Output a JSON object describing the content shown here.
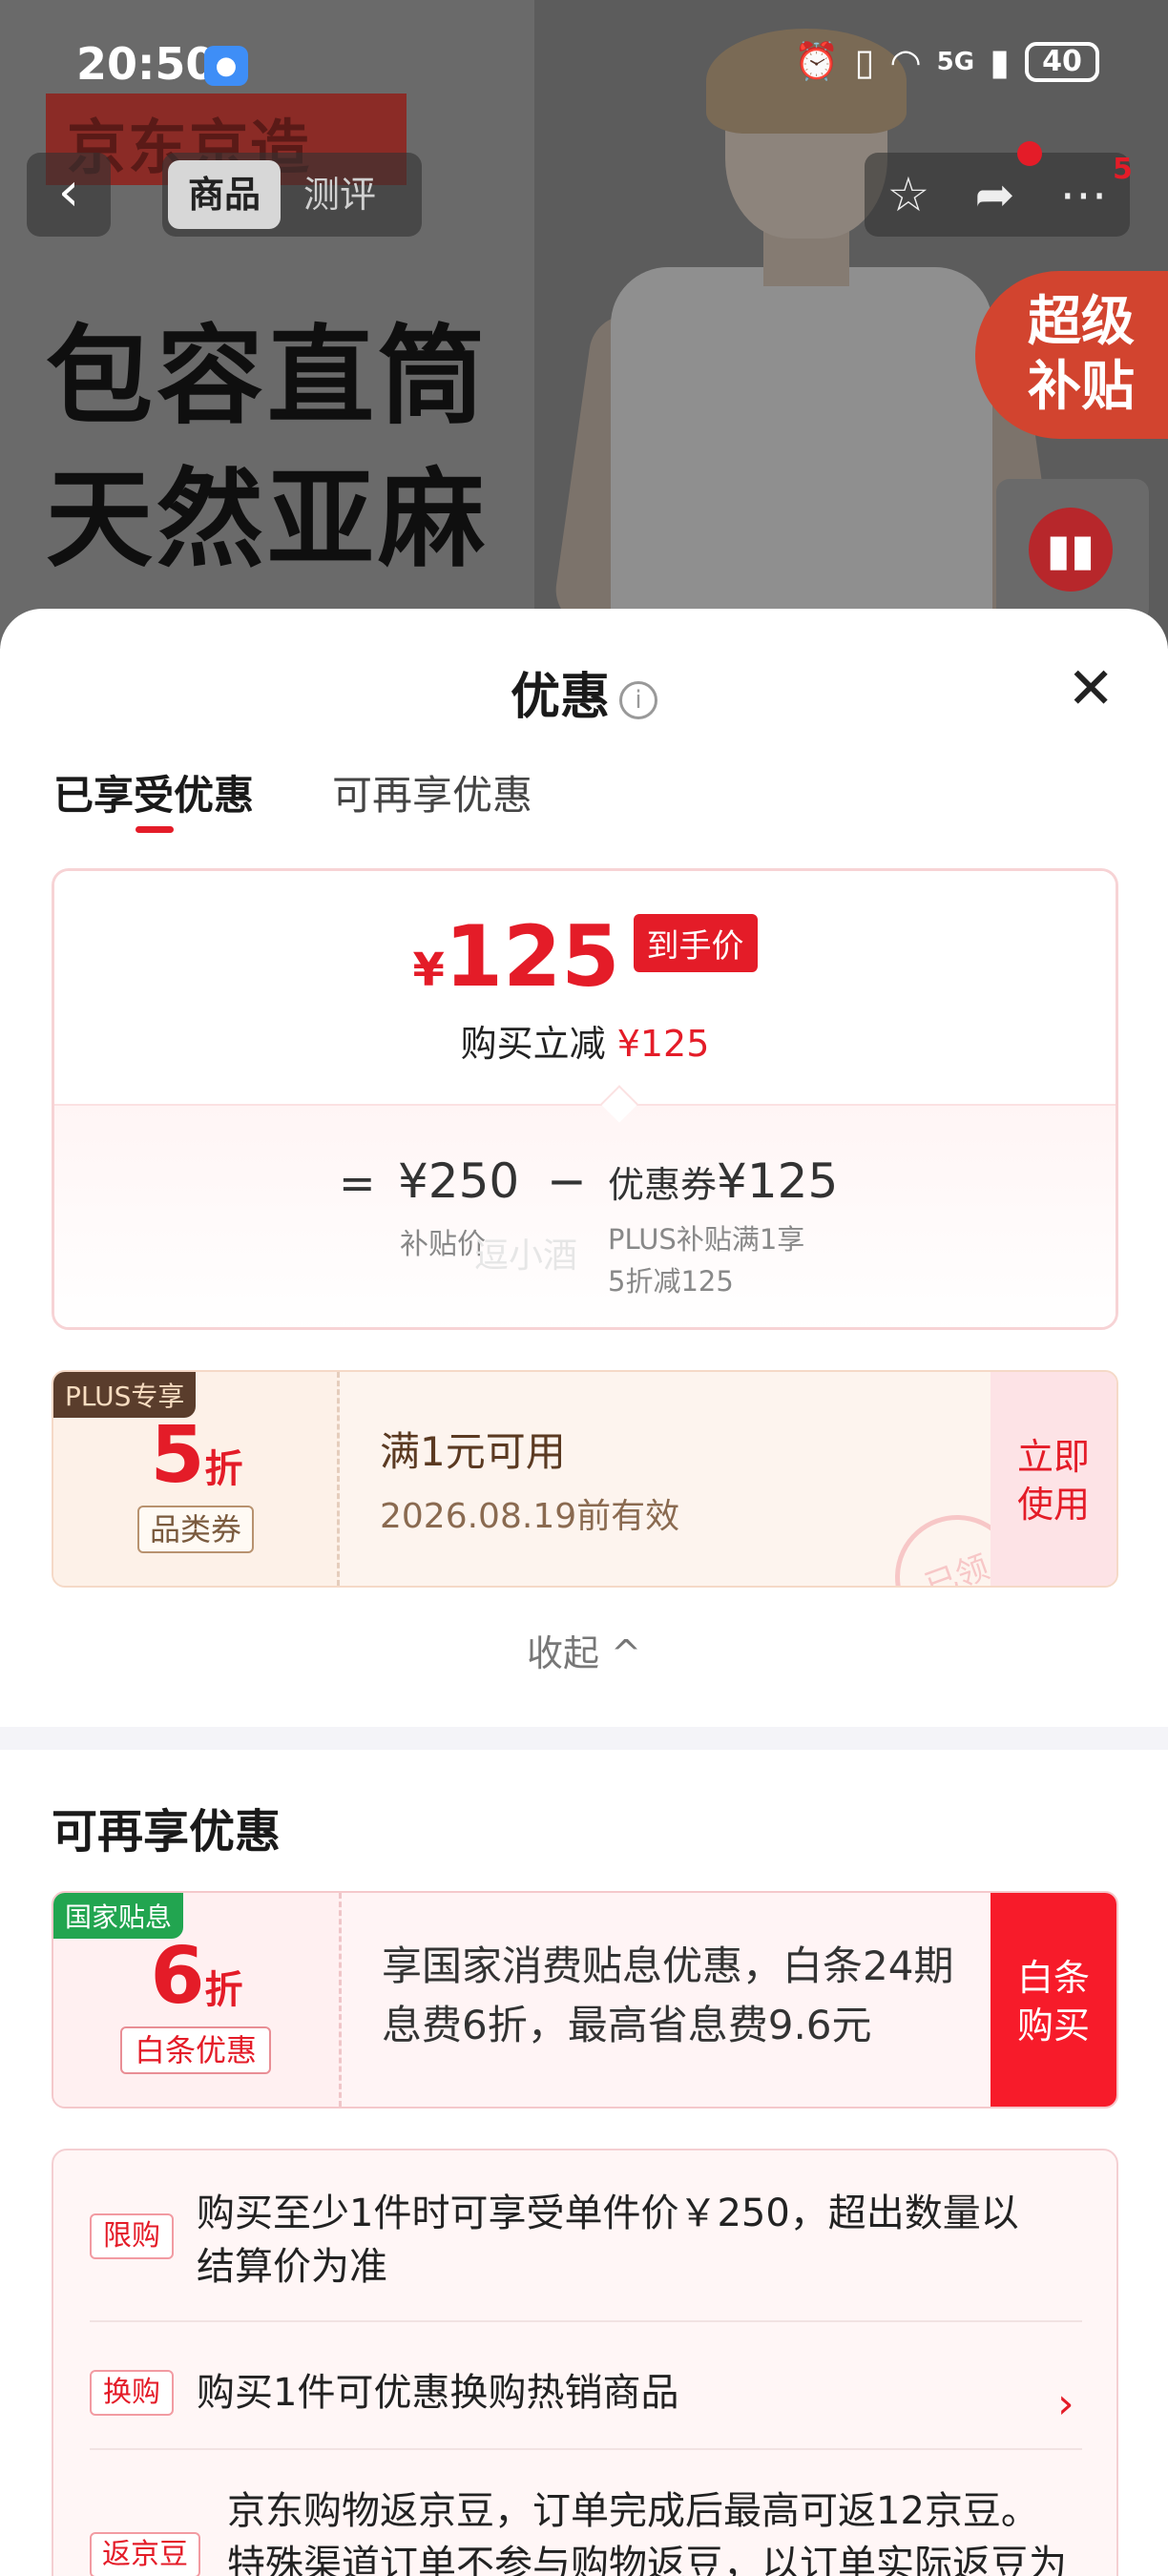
{
  "status_bar": {
    "time": "20:50",
    "battery": "40",
    "network": "5G"
  },
  "nav": {
    "back_icon": "chevron-left-icon",
    "tabs": [
      "商品",
      "测评"
    ],
    "badge_count": "5"
  },
  "hero": {
    "brand": "京东京造",
    "slogan_line1": "包容直筒",
    "slogan_line2": "天然亚麻",
    "super_subsidy_line1": "超级",
    "super_subsidy_line2": "补贴"
  },
  "sheet": {
    "title": "优惠",
    "tabs": [
      "已享受优惠",
      "可再享优惠"
    ],
    "active_tab": 0,
    "accent_color": "#e41c28"
  },
  "price_card": {
    "currency": "¥",
    "final_price": "125",
    "final_badge": "到手价",
    "instant_label": "购买立减",
    "instant_value": "¥125",
    "eq": "=",
    "base_price": "¥250",
    "base_label": "补贴价",
    "minus": "−",
    "coupon_label": "优惠券",
    "coupon_value": "¥125",
    "coupon_desc_line1": "PLUS补贴满1享",
    "coupon_desc_line2": "5折减125",
    "watermark": "逗小酒"
  },
  "coupon_plus": {
    "tag": "PLUS专享",
    "discount_num": "5",
    "discount_unit": "折",
    "category": "品类券",
    "condition": "满1元可用",
    "valid_until": "2026.08.19前有效",
    "use_line1": "立即",
    "use_line2": "使用",
    "stamp": "已领"
  },
  "collapse_label": "收起 ^",
  "more_section": {
    "title": "可再享优惠",
    "baitiao": {
      "tag": "国家贴息",
      "discount_num": "6",
      "discount_unit": "折",
      "category": "白条优惠",
      "desc": "享国家消费贴息优惠，白条24期息费6折，最高省息费9.6元",
      "btn_line1": "白条",
      "btn_line2": "购买"
    }
  },
  "rules": [
    {
      "tag": "限购",
      "text": "购买至少1件时可享受单件价￥250，超出数量以结算价为准"
    },
    {
      "tag": "换购",
      "text": "购买1件可优惠换购热销商品"
    },
    {
      "tag": "返京豆",
      "text": "京东购物返京豆，订单完成后最高可返12京豆。特殊渠道订单不参与购物返豆，以订单实际返豆为"
    }
  ]
}
